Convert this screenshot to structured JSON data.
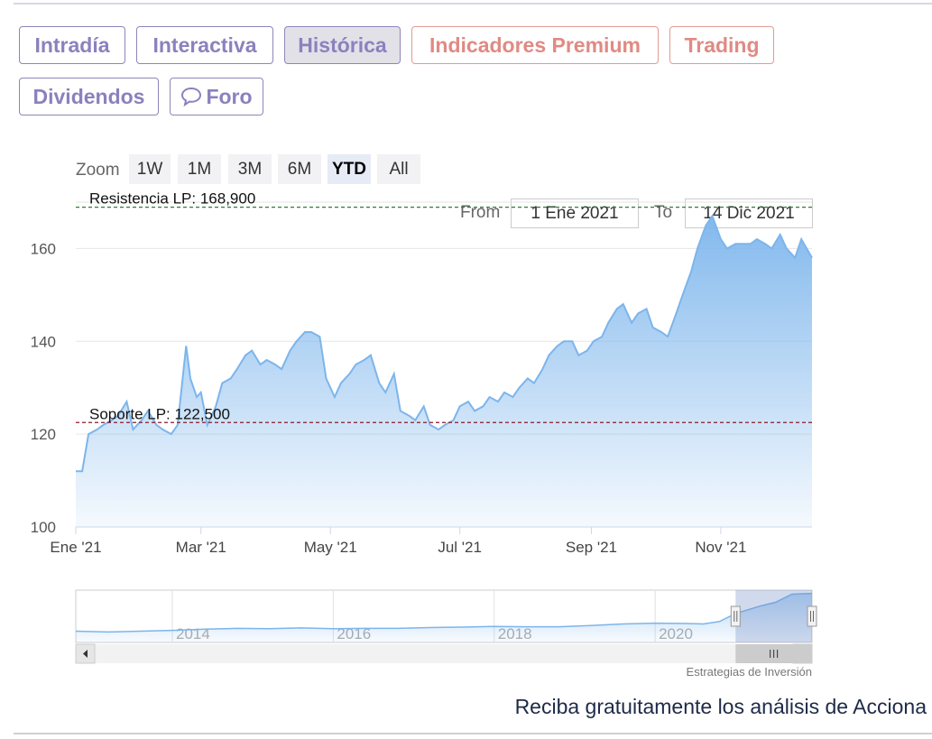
{
  "tabs": [
    {
      "label": "Intradía",
      "style": "normal"
    },
    {
      "label": "Interactiva",
      "style": "normal"
    },
    {
      "label": "Histórica",
      "style": "active"
    },
    {
      "label": "Indicadores Premium",
      "style": "premium"
    },
    {
      "label": "Trading",
      "style": "premium"
    },
    {
      "label": "Dividendos",
      "style": "normal"
    },
    {
      "label": "Foro",
      "style": "normal",
      "icon": "chat-bubble-icon"
    }
  ],
  "zoom": {
    "label": "Zoom",
    "buttons": [
      "1W",
      "1M",
      "3M",
      "6M",
      "YTD",
      "All"
    ],
    "selected": "YTD"
  },
  "range": {
    "from_label": "From",
    "from_value": "1 Ene 2021",
    "to_label": "To",
    "to_value": "14 Dic 2021"
  },
  "colors": {
    "accent": "#8a82bd",
    "premium": "#e08a84",
    "series": "#7cb5ec",
    "resistance": "#2e7d32",
    "support": "#8b1a2a"
  },
  "chart_data": {
    "type": "area",
    "title": "",
    "xlabel": "",
    "ylabel": "",
    "ylim": [
      100,
      170
    ],
    "yticks": [
      100,
      120,
      140,
      160
    ],
    "xtick_labels": [
      "Ene '21",
      "Mar '21",
      "May '21",
      "Jul '21",
      "Sep '21",
      "Nov '21"
    ],
    "xtick_dates": [
      "2021-01-01",
      "2021-03-01",
      "2021-05-01",
      "2021-07-01",
      "2021-09-01",
      "2021-11-01"
    ],
    "x_range": [
      "2021-01-01",
      "2021-12-14"
    ],
    "grid": true,
    "legend": "none",
    "series": [
      {
        "x": [
          "2021-01-01",
          "2021-01-04",
          "2021-01-07",
          "2021-01-11",
          "2021-01-14",
          "2021-01-18",
          "2021-01-21",
          "2021-01-25",
          "2021-01-28",
          "2021-02-01",
          "2021-02-04",
          "2021-02-08",
          "2021-02-11",
          "2021-02-15",
          "2021-02-18",
          "2021-02-22",
          "2021-02-24",
          "2021-02-27",
          "2021-03-01",
          "2021-03-04",
          "2021-03-08",
          "2021-03-11",
          "2021-03-15",
          "2021-03-18",
          "2021-03-22",
          "2021-03-25",
          "2021-03-29",
          "2021-04-01",
          "2021-04-05",
          "2021-04-08",
          "2021-04-12",
          "2021-04-15",
          "2021-04-19",
          "2021-04-22",
          "2021-04-26",
          "2021-04-29",
          "2021-05-03",
          "2021-05-06",
          "2021-05-10",
          "2021-05-13",
          "2021-05-17",
          "2021-05-20",
          "2021-05-24",
          "2021-05-27",
          "2021-05-31",
          "2021-06-03",
          "2021-06-07",
          "2021-06-10",
          "2021-06-14",
          "2021-06-17",
          "2021-06-21",
          "2021-06-24",
          "2021-06-28",
          "2021-07-01",
          "2021-07-05",
          "2021-07-08",
          "2021-07-12",
          "2021-07-15",
          "2021-07-19",
          "2021-07-22",
          "2021-07-26",
          "2021-07-29",
          "2021-08-02",
          "2021-08-05",
          "2021-08-09",
          "2021-08-12",
          "2021-08-16",
          "2021-08-19",
          "2021-08-23",
          "2021-08-26",
          "2021-08-30",
          "2021-09-02",
          "2021-09-06",
          "2021-09-09",
          "2021-09-13",
          "2021-09-16",
          "2021-09-20",
          "2021-09-23",
          "2021-09-27",
          "2021-09-30",
          "2021-10-04",
          "2021-10-07",
          "2021-10-11",
          "2021-10-14",
          "2021-10-18",
          "2021-10-21",
          "2021-10-25",
          "2021-10-28",
          "2021-11-01",
          "2021-11-04",
          "2021-11-08",
          "2021-11-11",
          "2021-11-15",
          "2021-11-18",
          "2021-11-22",
          "2021-11-25",
          "2021-11-29",
          "2021-12-02",
          "2021-12-06",
          "2021-12-09",
          "2021-12-14"
        ],
        "values": [
          112,
          112,
          120,
          121,
          122,
          123,
          124,
          127,
          121,
          123,
          125,
          122,
          121,
          120,
          122,
          139,
          132,
          128,
          129,
          122,
          126,
          131,
          132,
          134,
          137,
          138,
          135,
          136,
          135,
          134,
          138,
          140,
          142,
          142,
          141,
          132,
          128,
          131,
          133,
          135,
          136,
          137,
          131,
          129,
          133,
          125,
          124,
          123,
          126,
          122,
          121,
          122,
          123,
          126,
          127,
          125,
          126,
          128,
          127,
          129,
          128,
          130,
          132,
          131,
          134,
          137,
          139,
          140,
          140,
          137,
          138,
          140,
          141,
          144,
          147,
          148,
          144,
          146,
          147,
          143,
          142,
          141,
          146,
          150,
          155,
          160,
          165,
          167,
          162,
          160,
          161,
          161,
          161,
          162,
          161,
          160,
          163,
          160,
          158,
          162,
          158
        ]
      }
    ],
    "annotations": [
      {
        "label": "Resistencia LP: 168,900",
        "value": 168.9
      },
      {
        "label": "Soporte LP: 122,500",
        "value": 122.5
      }
    ],
    "navigator": {
      "tick_labels": [
        "2014",
        "2016",
        "2018",
        "2020"
      ],
      "tick_years": [
        2014,
        2016,
        2018,
        2020
      ],
      "x_range": [
        2012.8,
        2021.95
      ],
      "selected_range": [
        2021.0,
        2021.95
      ],
      "years": [
        2012.8,
        2013.2,
        2013.6,
        2014.0,
        2014.4,
        2014.8,
        2015.2,
        2015.6,
        2016.0,
        2016.4,
        2016.8,
        2017.2,
        2017.6,
        2018.0,
        2018.4,
        2018.8,
        2019.2,
        2019.6,
        2020.0,
        2020.4,
        2020.6,
        2020.8,
        2021.0,
        2021.3,
        2021.5,
        2021.7,
        2021.95
      ],
      "values": [
        68,
        66,
        68,
        70,
        73,
        75,
        74,
        76,
        74,
        75,
        75,
        77,
        78,
        80,
        79,
        79,
        82,
        86,
        88,
        87,
        86,
        92,
        112,
        130,
        140,
        160,
        162
      ]
    }
  },
  "credit": "Estrategias de Inversión",
  "promo": "Reciba gratuitamente los análisis de Acciona"
}
